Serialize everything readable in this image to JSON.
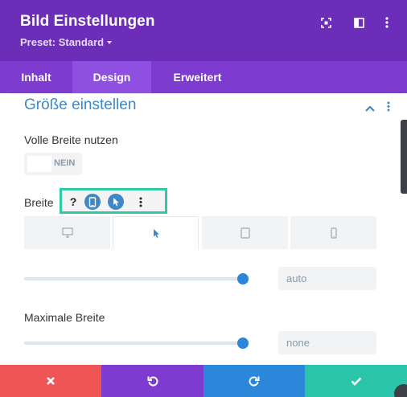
{
  "header": {
    "title": "Bild Einstellungen",
    "preset_label": "Preset: Standard",
    "icons": [
      "focus-icon",
      "split-view-icon",
      "more-icon"
    ],
    "background": "#6c2eb9"
  },
  "tabs": [
    {
      "label": "Inhalt",
      "active": false
    },
    {
      "label": "Design",
      "active": true
    },
    {
      "label": "Erweitert",
      "active": false
    }
  ],
  "section": {
    "title": "Größe einstellen",
    "expanded": true
  },
  "full_width": {
    "label": "Volle Breite nutzen",
    "value": "NEIN"
  },
  "width": {
    "label": "Breite",
    "hover_toolbar": {
      "help_label": "?",
      "icons": [
        "help-icon",
        "tablet-icon",
        "cursor-icon",
        "more-icon"
      ]
    },
    "device_tabs": [
      "desktop-icon",
      "cursor-hover-icon",
      "tablet-icon",
      "phone-icon"
    ],
    "active_device": 1,
    "slider_level": 1.0,
    "value": "auto"
  },
  "max_width": {
    "label": "Maximale Breite",
    "slider_level": 1.0,
    "value": "none"
  },
  "footer": {
    "buttons": [
      {
        "name": "cancel",
        "color": "#ef5555",
        "icon": "close-icon"
      },
      {
        "name": "undo",
        "color": "#7e3bd0",
        "icon": "undo-icon"
      },
      {
        "name": "redo",
        "color": "#2b87da",
        "icon": "redo-icon"
      },
      {
        "name": "save",
        "color": "#29c4a9",
        "icon": "check-icon"
      }
    ]
  },
  "colors": {
    "accent_blue": "#3f88c5",
    "highlight_green": "#2ec9a5"
  }
}
